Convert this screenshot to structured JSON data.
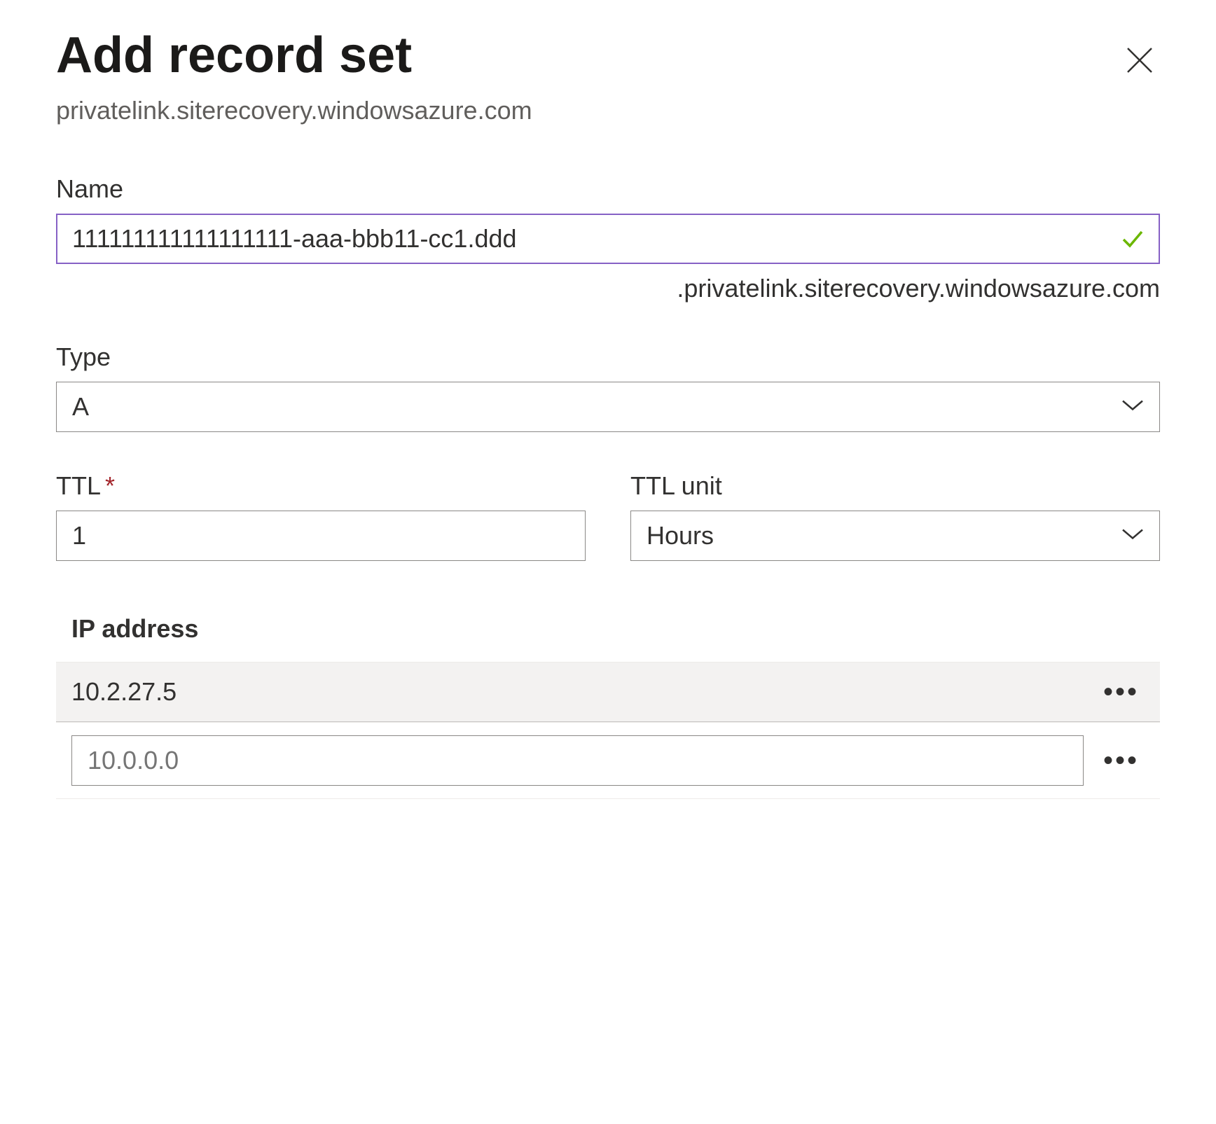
{
  "header": {
    "title": "Add record set",
    "subtitle": "privatelink.siterecovery.windowsazure.com"
  },
  "fields": {
    "name": {
      "label": "Name",
      "value": "111111111111111111-aaa-bbb11-cc1.ddd",
      "suffix": ".privatelink.siterecovery.windowsazure.com"
    },
    "type": {
      "label": "Type",
      "value": "A"
    },
    "ttl": {
      "label": "TTL",
      "value": "1"
    },
    "ttl_unit": {
      "label": "TTL unit",
      "value": "Hours"
    },
    "ip": {
      "label": "IP address",
      "rows": {
        "existing": "10.2.27.5",
        "placeholder": "10.0.0.0"
      }
    }
  },
  "icons": {
    "close": "close-icon",
    "chevron": "chevron-down-icon",
    "check": "check-icon",
    "more": "more-icon"
  }
}
